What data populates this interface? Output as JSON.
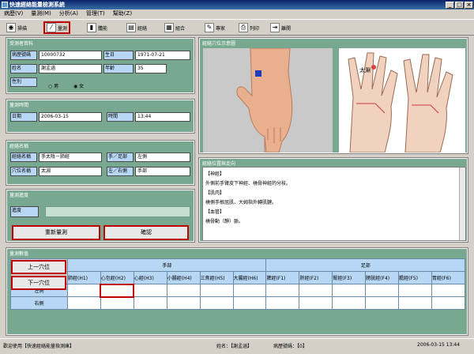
{
  "app": {
    "title": "快速經絡能量檢測系統"
  },
  "menu": [
    {
      "label": "病歷(V)"
    },
    {
      "label": "量測(M)"
    },
    {
      "label": "分析(A)"
    },
    {
      "label": "管理(T)"
    },
    {
      "label": "幫助(Z)"
    }
  ],
  "toolbar": {
    "items": [
      {
        "label": "掃描"
      },
      {
        "label": "量測"
      },
      {
        "label": "體能"
      },
      {
        "label": "經絡"
      },
      {
        "label": "組合"
      },
      {
        "label": "專家"
      },
      {
        "label": "列印"
      },
      {
        "label": "離開"
      }
    ]
  },
  "patient": {
    "section_title": "受測者資料",
    "record_no_label": "病歷號碼",
    "record_no": "10000732",
    "birthday_label": "生日",
    "birthday": "1971-07-21",
    "name_label": "姓名",
    "name": "謝孟涵",
    "age_label": "年齡",
    "age": "35",
    "gender_label": "性別",
    "gender_options": [
      "男",
      "女"
    ],
    "gender_selected": "女"
  },
  "measure_time": {
    "section_title": "量測時間",
    "date_label": "日期",
    "date": "2006-03-15",
    "time_label": "時間",
    "time": "13:44"
  },
  "meridian": {
    "section_title": "經絡名稱",
    "name_label": "經絡名稱",
    "name": "手太陰－肺經",
    "limb_label": "手／足部",
    "limb": "左側",
    "point_label": "穴位名稱",
    "point": "太淵",
    "side_label": "左／右側",
    "side": "手部"
  },
  "progress": {
    "section_title": "量測進度",
    "label": "進度",
    "value": 0,
    "remeasure_button": "重新量測",
    "confirm_button": "確認"
  },
  "diagram": {
    "title": "經絡穴位示意圖",
    "point_label": "太淵"
  },
  "position": {
    "title": "經絡位置與走向",
    "lines": [
      "【神經】",
      "外側前手臂皮下神經、橈骨神經的分枝。",
      "【肌肉】",
      "橈側手根屈肌、大姆指外轉肌腱。",
      "【血管】",
      "橈骨動（靜）脈。"
    ]
  },
  "values": {
    "section_title": "量測數值",
    "prev_button": "上一穴位",
    "next_button": "下一穴位",
    "hand_label": "手部",
    "foot_label": "足部",
    "columns": [
      "肺經(H1)",
      "心包經(H2)",
      "心經(H3)",
      "小腸經(H4)",
      "三焦經(H5)",
      "大腸經(H6)",
      "脾經(F1)",
      "肝經(F2)",
      "腎經(F3)",
      "膀胱經(F4)",
      "膽經(F5)",
      "胃經(F6)"
    ],
    "left_label": "左側",
    "right_label": "右側"
  },
  "status": {
    "welcome": "歡迎使用【快速經絡能量檢測庫】",
    "name": "姓名：【謝孟涵】",
    "record": "病歷號碼：【0】",
    "datetime": "2006-03-15 13:44"
  }
}
